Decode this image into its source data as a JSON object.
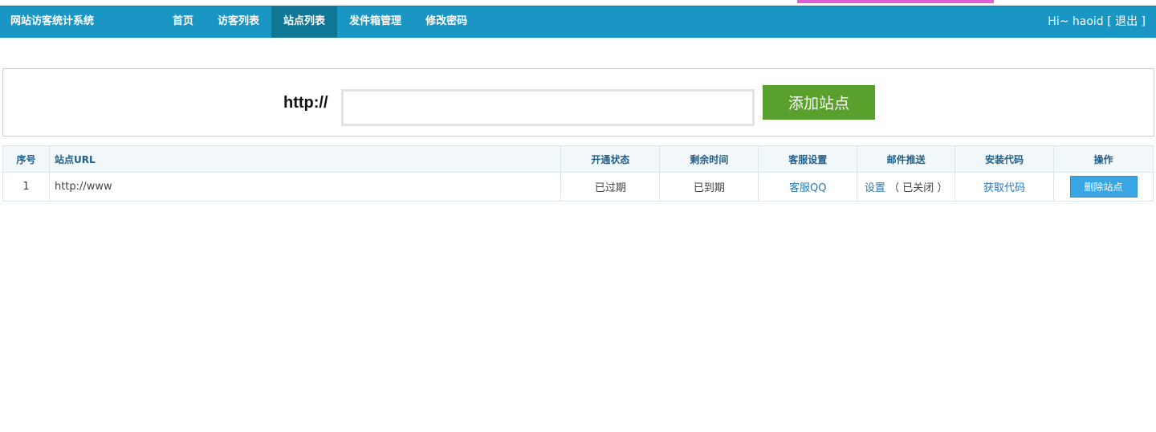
{
  "app": {
    "brand": "网站访客统计系统",
    "nav": [
      {
        "label": "首页",
        "active": false
      },
      {
        "label": "访客列表",
        "active": false
      },
      {
        "label": "站点列表",
        "active": true
      },
      {
        "label": "发件箱管理",
        "active": false
      },
      {
        "label": "修改密码",
        "active": false
      }
    ],
    "user": {
      "greeting": "Hi~ haoid",
      "logout_prefix": " [ ",
      "logout": "退出",
      "logout_suffix": " ]"
    }
  },
  "add_site": {
    "prefix": "http://",
    "input_value": "",
    "button": "添加站点"
  },
  "table": {
    "headers": [
      "序号",
      "站点URL",
      "开通状态",
      "剩余时间",
      "客服设置",
      "邮件推送",
      "安装代码",
      "操作"
    ],
    "rows": [
      {
        "index": "1",
        "url": "http://www",
        "status": "已过期",
        "remaining": "已到期",
        "service": "客服QQ",
        "email_link": "设置",
        "email_state": "（ 已关闭 ）",
        "code": "获取代码",
        "action": "删除站点"
      }
    ]
  },
  "colors": {
    "navbar": "#1a96c4",
    "nav_active": "#117797",
    "add_button": "#5aa02c",
    "delete_button": "#3aa5e3",
    "accent_bar": "#e15fd6"
  }
}
